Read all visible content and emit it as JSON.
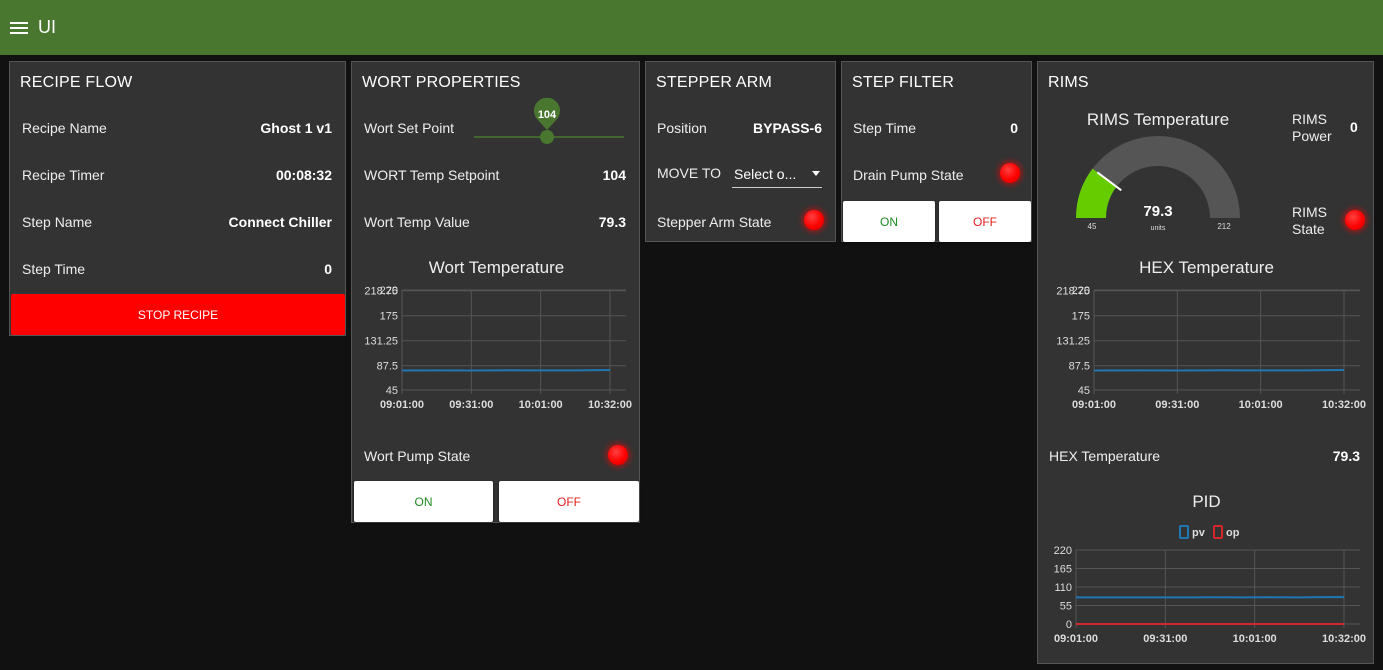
{
  "app": {
    "title": "UI"
  },
  "recipe_flow": {
    "title": "RECIPE FLOW",
    "rows": [
      {
        "label": "Recipe Name",
        "value": "Ghost 1 v1"
      },
      {
        "label": "Recipe Timer",
        "value": "00:08:32"
      },
      {
        "label": "Step Name",
        "value": "Connect Chiller"
      },
      {
        "label": "Step Time",
        "value": "0"
      }
    ],
    "stop_button": "STOP RECIPE",
    "stop_color": "#ff0000"
  },
  "wort_properties": {
    "title": "WORT PROPERTIES",
    "setpoint_label": "Wort Set Point",
    "slider": {
      "value": 104,
      "display": "104",
      "min": 45,
      "max": 212
    },
    "temp_setpoint_label": "WORT Temp Setpoint",
    "temp_setpoint_value": "104",
    "temp_value_label": "Wort Temp Value",
    "temp_value": "79.3",
    "pump_label": "Wort Pump State",
    "pump_state_color": "#ff0000",
    "on_label": "ON",
    "off_label": "OFF"
  },
  "stepper_arm": {
    "title": "STEPPER ARM",
    "position_label": "Position",
    "position_value": "BYPASS-6",
    "move_label": "MOVE TO",
    "select_value": "Select o...",
    "state_label": "Stepper Arm State",
    "state_color": "#ff0000"
  },
  "step_filter": {
    "title": "STEP FILTER",
    "step_time_label": "Step Time",
    "step_time_value": "0",
    "drain_label": "Drain Pump State",
    "drain_color": "#ff0000",
    "on_label": "ON",
    "off_label": "OFF"
  },
  "rims": {
    "title": "RIMS",
    "gauge": {
      "title": "RIMS Temperature",
      "value": 79.3,
      "value_text": "79.3",
      "units": "units",
      "min": 45,
      "max": 212,
      "min_label": "45",
      "max_label": "212",
      "fill_color": "#66cc00",
      "track_color": "#555555"
    },
    "power_label_1": "RIMS",
    "power_label_2": "Power",
    "power_value": "0",
    "state_label_1": "RIMS",
    "state_label_2": "State",
    "state_color": "#ff0000",
    "hex_label": "HEX Temperature",
    "hex_value": "79.3"
  },
  "chart_data": [
    {
      "type": "line",
      "title": "Wort Temperature",
      "ylim": [
        45,
        220
      ],
      "yticks": [
        45,
        87.5,
        131.25,
        175,
        218.75,
        220
      ],
      "ytick_labels": [
        "45",
        "87.5",
        "131.25",
        "175",
        "218.75",
        "220"
      ],
      "xticks": [
        "09:01:00",
        "09:31:00",
        "10:01:00",
        "10:32:00"
      ],
      "grid": true,
      "series": [
        {
          "color": "#1f77b4",
          "x": [
            0,
            0.5,
            1.0,
            1.3,
            1.55,
            1.85,
            2.2,
            2.5,
            2.8,
            3.0
          ],
          "values": [
            79.2,
            79.3,
            79.2,
            79.3,
            79.5,
            79.3,
            79.4,
            79.3,
            79.8,
            80.0
          ]
        }
      ]
    },
    {
      "type": "line",
      "title": "HEX Temperature",
      "ylim": [
        45,
        220
      ],
      "yticks": [
        45,
        87.5,
        131.25,
        175,
        218.75,
        220
      ],
      "ytick_labels": [
        "45",
        "87.5",
        "131.25",
        "175",
        "218.75",
        "220"
      ],
      "xticks": [
        "09:01:00",
        "09:31:00",
        "10:01:00",
        "10:32:00"
      ],
      "grid": true,
      "series": [
        {
          "color": "#1f77b4",
          "x": [
            0,
            0.5,
            1.0,
            1.3,
            1.55,
            1.85,
            2.2,
            2.5,
            2.8,
            3.0
          ],
          "values": [
            79.2,
            79.3,
            79.2,
            79.3,
            79.5,
            79.3,
            79.4,
            79.3,
            79.8,
            80.0
          ]
        }
      ]
    },
    {
      "type": "line",
      "title": "PID",
      "ylim": [
        0,
        220
      ],
      "yticks": [
        0,
        55,
        110,
        165,
        220
      ],
      "ytick_labels": [
        "0",
        "55",
        "110",
        "165",
        "220"
      ],
      "xticks": [
        "09:01:00",
        "09:31:00",
        "10:01:00",
        "10:32:00"
      ],
      "grid": true,
      "legend": "top-center",
      "series": [
        {
          "name": "pv",
          "color": "#1f77b4",
          "x": [
            0,
            0.5,
            1.0,
            1.3,
            1.55,
            1.85,
            2.2,
            2.5,
            2.8,
            3.0
          ],
          "values": [
            79.2,
            79.3,
            79.2,
            79.3,
            79.5,
            79.3,
            79.4,
            79.3,
            79.8,
            80.0
          ]
        },
        {
          "name": "op",
          "color": "#d62728",
          "x": [
            0,
            3.0
          ],
          "values": [
            0,
            0
          ]
        }
      ]
    }
  ]
}
